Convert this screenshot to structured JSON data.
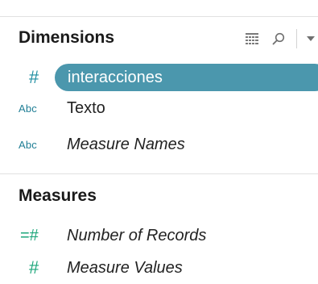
{
  "dimensions": {
    "title": "Dimensions",
    "tools": {
      "grid_icon": "list-view-icon",
      "search_icon": "search-icon",
      "menu_icon": "dropdown-arrow-icon"
    },
    "fields": [
      {
        "type_label": "#",
        "type": "number",
        "name": "interacciones",
        "selected": true,
        "italic": false
      },
      {
        "type_label": "Abc",
        "type": "string",
        "name": "Texto",
        "selected": false,
        "italic": false
      },
      {
        "type_label": "Abc",
        "type": "string",
        "name": "Measure Names",
        "selected": false,
        "italic": true
      }
    ]
  },
  "measures": {
    "title": "Measures",
    "fields": [
      {
        "type_label": "=#",
        "type": "calculated-number",
        "name": "Number of Records",
        "italic": true
      },
      {
        "type_label": "#",
        "type": "number",
        "name": "Measure Values",
        "italic": true
      }
    ]
  },
  "colors": {
    "selection_fill": "#4b97ad",
    "dimension_icon": "#1f8ea2",
    "measure_icon": "#1ea77b"
  }
}
